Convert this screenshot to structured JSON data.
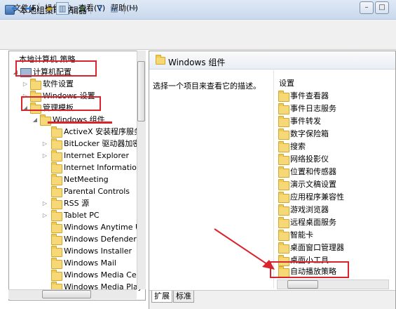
{
  "window": {
    "title": "本地组策略编辑器",
    "controls": [
      "minimize",
      "maximize",
      "close"
    ]
  },
  "menubar": [
    {
      "label": "文件(F)"
    },
    {
      "label": "操作(A)"
    },
    {
      "label": "查看(V)"
    },
    {
      "label": "帮助(H)"
    }
  ],
  "toolbar": [
    "back-arrow-icon",
    "forward-arrow-icon",
    "up-folder-icon",
    "console-tree-icon",
    "export-icon",
    "help-icon",
    "properties-icon",
    "filter-icon"
  ],
  "tree": {
    "root": "本地计算机 策略",
    "computer_config": "计算机配置",
    "software_settings": "软件设置",
    "windows_settings": "Windows 设置",
    "admin_templates": "管理模板",
    "windows_components": "Windows 组件",
    "children": [
      "ActiveX 安装程序服务",
      "BitLocker 驱动器加密",
      "Internet Explorer",
      "Internet Information",
      "NetMeeting",
      "Parental Controls",
      "RSS 源",
      "Tablet PC",
      "Windows Anytime Up",
      "Windows Defender",
      "Windows Installer",
      "Windows Mail",
      "Windows Media Cen",
      "Windows Media Play"
    ]
  },
  "right_panel": {
    "title": "Windows 组件",
    "description": "选择一个项目来查看它的描述。",
    "column_header": "设置",
    "items": [
      "事件查看器",
      "事件日志服务",
      "事件转发",
      "数字保险箱",
      "搜索",
      "网络投影仪",
      "位置和传感器",
      "演示文稿设置",
      "应用程序兼容性",
      "游戏浏览器",
      "远程桌面服务",
      "智能卡",
      "桌面窗口管理器",
      "桌面小工具",
      "自动播放策略"
    ]
  },
  "tabs": [
    {
      "label": "扩展"
    },
    {
      "label": "标准"
    }
  ],
  "colors": {
    "annotation": "#d9232d",
    "folder": "#f7d877"
  }
}
